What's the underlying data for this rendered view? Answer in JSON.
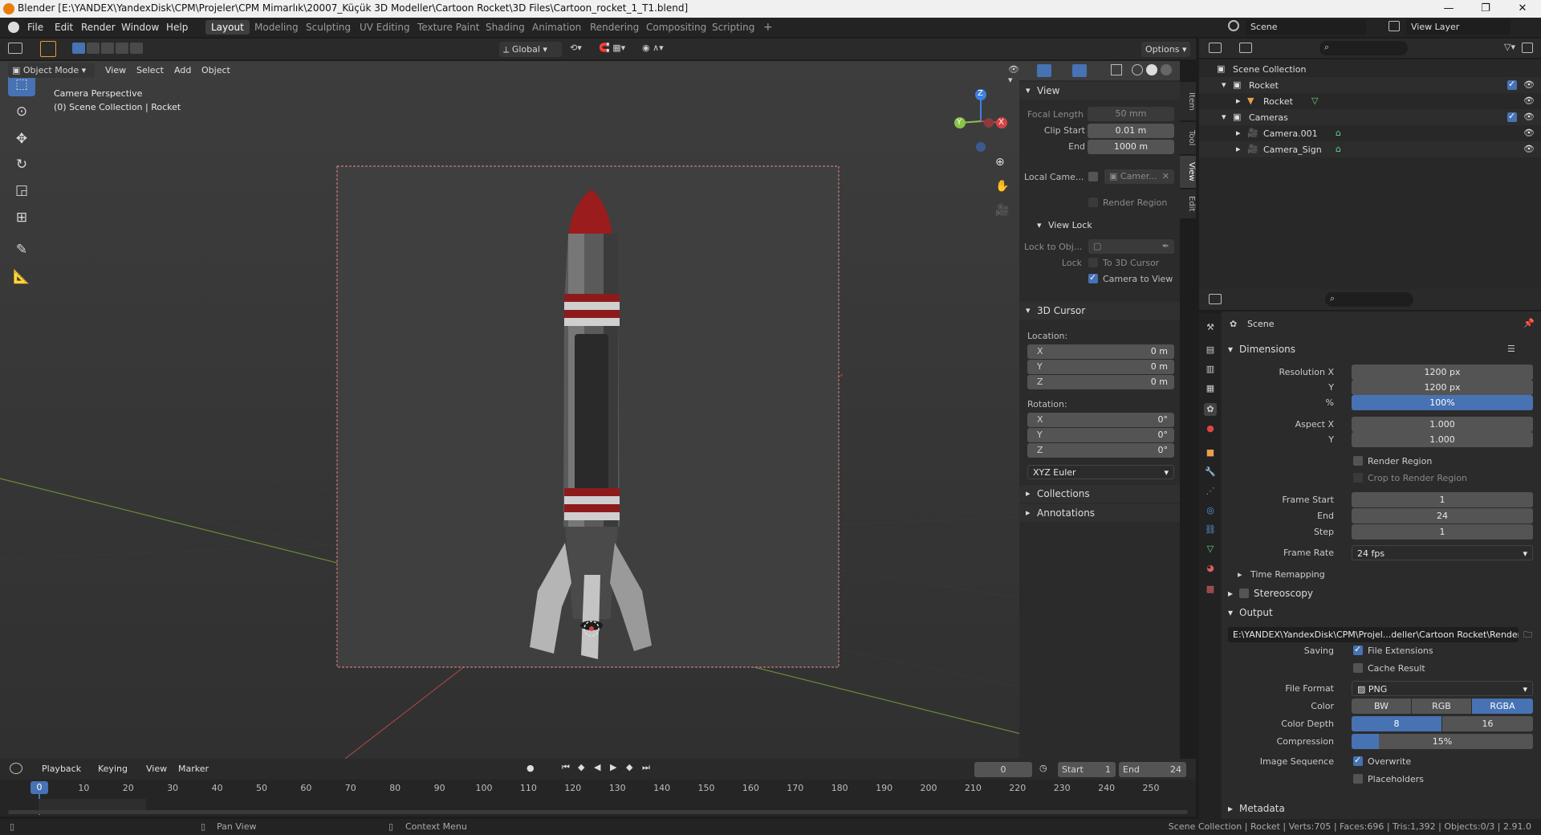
{
  "titlebar": {
    "title": "Blender [E:\\YANDEX\\YandexDisk\\CPM\\Projeler\\CPM Mimarlık\\20007_Küçük 3D Modeller\\Cartoon Rocket\\3D Files\\Cartoon_rocket_1_T1.blend]",
    "minimize": "—",
    "maximize": "❐",
    "close": "✕"
  },
  "menubar": {
    "items": [
      "File",
      "Edit",
      "Render",
      "Window",
      "Help"
    ]
  },
  "workspaces": {
    "tabs": [
      "Layout",
      "Modeling",
      "Sculpting",
      "UV Editing",
      "Texture Paint",
      "Shading",
      "Animation",
      "Rendering",
      "Compositing",
      "Scripting"
    ],
    "active": "Layout",
    "add": "+"
  },
  "scene_selector": {
    "scene": "Scene",
    "view_layer": "View Layer"
  },
  "tool_header": {
    "transform_orientation": "Global",
    "options": "Options"
  },
  "viewport_header": {
    "mode": "Object Mode",
    "menus": [
      "View",
      "Select",
      "Add",
      "Object"
    ]
  },
  "viewport": {
    "overlay_line1": "Camera Perspective",
    "overlay_line2": "(0) Scene Collection | Rocket",
    "gizmo": {
      "x": "X",
      "y": "Y",
      "z": "Z"
    }
  },
  "npanel": {
    "tabs": [
      "Item",
      "Tool",
      "View",
      "Edit"
    ],
    "view": {
      "title": "View",
      "focal_length_label": "Focal Length",
      "focal_length": "50 mm",
      "clip_start_label": "Clip Start",
      "clip_start": "0.01 m",
      "end_label": "End",
      "end": "1000 m",
      "local_camera_label": "Local Came...",
      "local_camera_value": "Camer...",
      "render_region": "Render Region"
    },
    "view_lock": {
      "title": "View Lock",
      "lock_to_obj_label": "Lock to Obj...",
      "lock_label": "Lock",
      "to_3d_cursor": "To 3D Cursor",
      "camera_to_view": "Camera to View"
    },
    "cursor": {
      "title": "3D Cursor",
      "location_label": "Location:",
      "loc": [
        {
          "axis": "X",
          "value": "0 m"
        },
        {
          "axis": "Y",
          "value": "0 m"
        },
        {
          "axis": "Z",
          "value": "0 m"
        }
      ],
      "rotation_label": "Rotation:",
      "rot": [
        {
          "axis": "X",
          "value": "0°"
        },
        {
          "axis": "Y",
          "value": "0°"
        },
        {
          "axis": "Z",
          "value": "0°"
        }
      ],
      "rotation_mode": "XYZ Euler"
    },
    "collections": "Collections",
    "annotations": "Annotations"
  },
  "outliner": {
    "rows": [
      {
        "label": "Scene Collection"
      },
      {
        "label": "Rocket"
      },
      {
        "label": "Rocket"
      },
      {
        "label": "Cameras"
      },
      {
        "label": "Camera.001"
      },
      {
        "label": "Camera_Sign"
      }
    ]
  },
  "properties": {
    "context": "Scene",
    "dimensions": {
      "title": "Dimensions",
      "resolution_x_label": "Resolution X",
      "resolution_x": "1200 px",
      "y_label": "Y",
      "resolution_y": "1200 px",
      "pct_label": "%",
      "pct": "100%",
      "aspect_x_label": "Aspect X",
      "aspect_x": "1.000",
      "aspect_y_label": "Y",
      "aspect_y": "1.000",
      "render_region": "Render Region",
      "crop": "Crop to Render Region",
      "frame_start_label": "Frame Start",
      "frame_start": "1",
      "end_label": "End",
      "frame_end": "24",
      "step_label": "Step",
      "step": "1",
      "frame_rate_label": "Frame Rate",
      "frame_rate": "24 fps",
      "time_remapping": "Time Remapping"
    },
    "stereoscopy": "Stereoscopy",
    "output": {
      "title": "Output",
      "path": "E:\\YANDEX\\YandexDisk\\CPM\\Projel...deller\\Cartoon Rocket\\Render\\Turn\\",
      "saving_label": "Saving",
      "file_extensions": "File Extensions",
      "cache_result": "Cache Result",
      "file_format_label": "File Format",
      "file_format": "PNG",
      "color_label": "Color",
      "color_options": [
        "BW",
        "RGB",
        "RGBA"
      ],
      "color_selected": "RGBA",
      "color_depth_label": "Color Depth",
      "depth_options": [
        "8",
        "16"
      ],
      "depth_selected": "8",
      "compression_label": "Compression",
      "compression": "15%",
      "image_sequence_label": "Image Sequence",
      "overwrite": "Overwrite",
      "placeholders": "Placeholders"
    },
    "metadata": "Metadata"
  },
  "timeline": {
    "menus": [
      "Playback",
      "Keying",
      "View",
      "Marker"
    ],
    "current_frame": "0",
    "start_label": "Start",
    "start": "1",
    "end_label": "End",
    "end": "24",
    "ticks": [
      "0",
      "10",
      "20",
      "30",
      "40",
      "50",
      "60",
      "70",
      "80",
      "90",
      "100",
      "110",
      "120",
      "130",
      "140",
      "150",
      "160",
      "170",
      "180",
      "190",
      "200",
      "210",
      "220",
      "230",
      "240",
      "250"
    ]
  },
  "statusbar": {
    "pan_view": "Pan View",
    "context_menu": "Context Menu",
    "stats": "Scene Collection | Rocket | Verts:705 | Faces:696 | Tris:1,392 | Objects:0/3 | 2.91.0"
  },
  "colors": {
    "accent": "#4772b3",
    "blender_orange": "#e87d0d",
    "x_axis": "#d44444",
    "y_axis": "#8bc34a",
    "z_axis": "#3f7fe0"
  }
}
